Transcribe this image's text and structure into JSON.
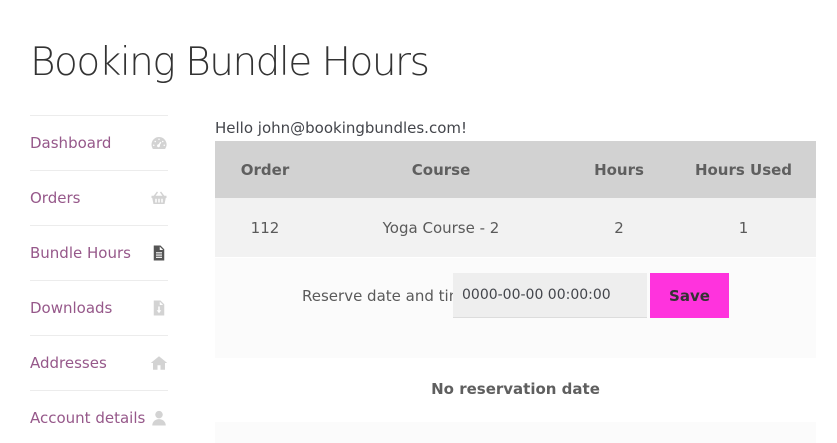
{
  "page": {
    "title": "Booking Bundle Hours"
  },
  "nav": {
    "items": [
      {
        "label": "Dashboard",
        "icon": "dashboard-icon",
        "active": false
      },
      {
        "label": "Orders",
        "icon": "basket-icon",
        "active": false
      },
      {
        "label": "Bundle Hours",
        "icon": "document-icon",
        "active": true
      },
      {
        "label": "Downloads",
        "icon": "download-file-icon",
        "active": false
      },
      {
        "label": "Addresses",
        "icon": "home-icon",
        "active": false
      },
      {
        "label": "Account details",
        "icon": "user-icon",
        "active": false
      }
    ]
  },
  "greeting": "Hello john@bookingbundles.com!",
  "table": {
    "headers": [
      "Order",
      "Course",
      "Hours",
      "Hours Used"
    ],
    "rows": [
      [
        "112",
        "Yoga Course - 2",
        "2",
        "1"
      ]
    ]
  },
  "reserve": {
    "label": "Reserve date and time",
    "value": "0000-00-00 00:00:00",
    "save_label": "Save"
  },
  "status": "No reservation date",
  "colors": {
    "link": "#96588a",
    "save_button": "#ff33dd",
    "table_header_bg": "#d2d2d2",
    "table_row_bg": "#f2f2f2"
  }
}
